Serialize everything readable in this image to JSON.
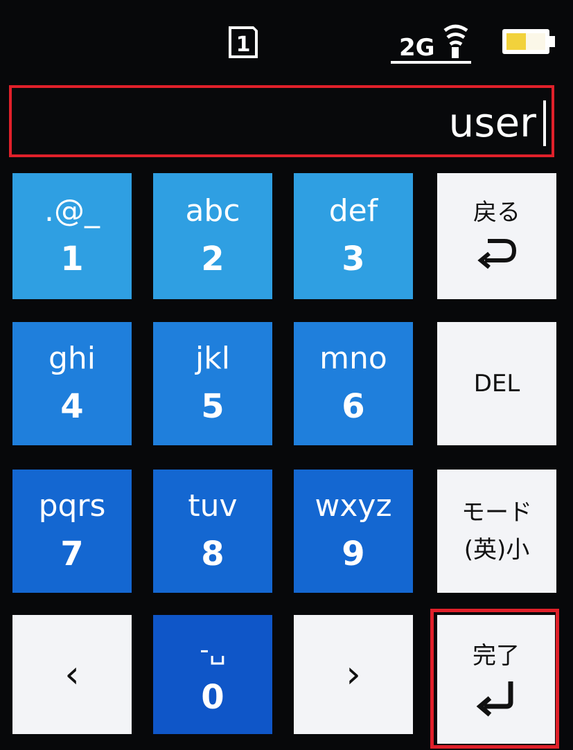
{
  "status_bar": {
    "sim_slot": "1",
    "network": "2G"
  },
  "text_field": {
    "value": "user"
  },
  "keypad": {
    "keys": [
      {
        "letters": ".@_",
        "digit": "1"
      },
      {
        "letters": "abc",
        "digit": "2"
      },
      {
        "letters": "def",
        "digit": "3"
      },
      {
        "letters": "ghi",
        "digit": "4"
      },
      {
        "letters": "jkl",
        "digit": "5"
      },
      {
        "letters": "mno",
        "digit": "6"
      },
      {
        "letters": "pqrs",
        "digit": "7"
      },
      {
        "letters": "tuv",
        "digit": "8"
      },
      {
        "letters": "wxyz",
        "digit": "9"
      },
      {
        "letters": "-␣",
        "digit": "0"
      }
    ],
    "back_label": "戻る",
    "del_label": "DEL",
    "mode_label_line1": "モード",
    "mode_label_line2": "(英)小",
    "done_label": "完了",
    "left_arrow": "‹",
    "right_arrow": "›"
  },
  "colors": {
    "accent_highlight": "#e0202a",
    "key_blue_light": "#2f9fe2",
    "key_blue_mid": "#1f7fdc",
    "key_blue_dark": "#1467d1",
    "key_gray": "#f3f4f7"
  },
  "icons": {
    "sim": "sim-card-icon",
    "signal": "signal-2g-icon",
    "battery": "battery-icon",
    "back": "return-arrow-icon",
    "done": "enter-arrow-icon"
  }
}
